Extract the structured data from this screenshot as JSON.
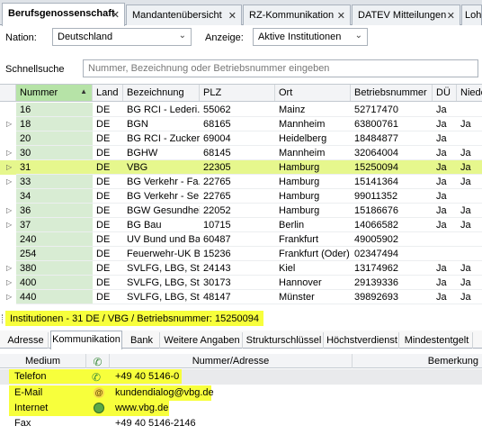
{
  "tabs": [
    {
      "label": "Berufsgenossenschaft",
      "active": true
    },
    {
      "label": "Mandantenübersicht"
    },
    {
      "label": "RZ-Kommunikation"
    },
    {
      "label": "DATEV Mitteilungen"
    },
    {
      "label": "Lohn"
    }
  ],
  "filter": {
    "nation_label": "Nation:",
    "nation_value": "Deutschland",
    "anzeige_label": "Anzeige:",
    "anzeige_value": "Aktive Institutionen",
    "search_label": "Schnellsuche",
    "search_placeholder": "Nummer, Bezeichnung oder Betriebsnummer eingeben"
  },
  "grid": {
    "columns": [
      "Nummer",
      "Land",
      "Bezeichnung",
      "PLZ",
      "Ort",
      "Betriebsnummer",
      "DÜ",
      "Niede"
    ],
    "rows": [
      {
        "nummer": "16",
        "land": "DE",
        "bez": "BG RCI - Lederi...",
        "plz": "55062",
        "ort": "Mainz",
        "bnr": "52717470",
        "du": "Ja",
        "nie": "",
        "exp": false
      },
      {
        "nummer": "18",
        "land": "DE",
        "bez": "BGN",
        "plz": "68165",
        "ort": "Mannheim",
        "bnr": "63800761",
        "du": "Ja",
        "nie": "Ja",
        "exp": true
      },
      {
        "nummer": "20",
        "land": "DE",
        "bez": "BG RCI - Zucker",
        "plz": "69004",
        "ort": "Heidelberg",
        "bnr": "18484877",
        "du": "Ja",
        "nie": "",
        "exp": false
      },
      {
        "nummer": "30",
        "land": "DE",
        "bez": "BGHW",
        "plz": "68145",
        "ort": "Mannheim",
        "bnr": "32064004",
        "du": "Ja",
        "nie": "Ja",
        "exp": true
      },
      {
        "nummer": "31",
        "land": "DE",
        "bez": "VBG",
        "plz": "22305",
        "ort": "Hamburg",
        "bnr": "15250094",
        "du": "Ja",
        "nie": "Ja",
        "exp": true,
        "selected": true
      },
      {
        "nummer": "33",
        "land": "DE",
        "bez": "BG Verkehr - Fa...",
        "plz": "22765",
        "ort": "Hamburg",
        "bnr": "15141364",
        "du": "Ja",
        "nie": "Ja",
        "exp": true
      },
      {
        "nummer": "34",
        "land": "DE",
        "bez": "BG Verkehr - Se...",
        "plz": "22765",
        "ort": "Hamburg",
        "bnr": "99011352",
        "du": "Ja",
        "nie": "",
        "exp": false
      },
      {
        "nummer": "36",
        "land": "DE",
        "bez": "BGW Gesundhei...",
        "plz": "22052",
        "ort": "Hamburg",
        "bnr": "15186676",
        "du": "Ja",
        "nie": "Ja",
        "exp": true
      },
      {
        "nummer": "37",
        "land": "DE",
        "bez": "BG Bau",
        "plz": "10715",
        "ort": "Berlin",
        "bnr": "14066582",
        "du": "Ja",
        "nie": "Ja",
        "exp": true
      },
      {
        "nummer": "240",
        "land": "DE",
        "bez": "UV Bund und Ba...",
        "plz": "60487",
        "ort": "Frankfurt",
        "bnr": "49005902",
        "du": "",
        "nie": "",
        "exp": false
      },
      {
        "nummer": "254",
        "land": "DE",
        "bez": "Feuerwehr-UK B...",
        "plz": "15236",
        "ort": "Frankfurt (Oder)",
        "bnr": "02347494",
        "du": "",
        "nie": "",
        "exp": false
      },
      {
        "nummer": "380",
        "land": "DE",
        "bez": "SVLFG, LBG, St...",
        "plz": "24143",
        "ort": "Kiel",
        "bnr": "13174962",
        "du": "Ja",
        "nie": "Ja",
        "exp": true
      },
      {
        "nummer": "400",
        "land": "DE",
        "bez": "SVLFG, LBG, St...",
        "plz": "30173",
        "ort": "Hannover",
        "bnr": "29139336",
        "du": "Ja",
        "nie": "Ja",
        "exp": true
      },
      {
        "nummer": "440",
        "land": "DE",
        "bez": "SVLFG, LBG, St...",
        "plz": "48147",
        "ort": "Münster",
        "bnr": "39892693",
        "du": "Ja",
        "nie": "Ja",
        "exp": true
      }
    ]
  },
  "status": {
    "text": "Institutionen - 31 DE / VBG / Betriebsnummer: 15250094"
  },
  "detail_tabs": [
    "Adresse",
    "Kommunikation",
    "Bank",
    "Weitere Angaben",
    "Strukturschlüssel",
    "Höchstverdienst",
    "Mindestentgelt"
  ],
  "komm": {
    "headers": [
      "Medium",
      "",
      "Nummer/Adresse",
      "Bemerkung"
    ],
    "rows": [
      {
        "medium": "Telefon",
        "icon": "phone-icon",
        "value": "+49 40 5146-0"
      },
      {
        "medium": "E-Mail",
        "icon": "at-icon",
        "value": "kundendialog@vbg.de"
      },
      {
        "medium": "Internet",
        "icon": "globe-icon",
        "value": "www.vbg.de"
      },
      {
        "medium": "Fax",
        "icon": "",
        "value": "+49 40 5146-2146"
      }
    ]
  },
  "colors": {
    "highlight": "#f7ff3c",
    "sort_header": "#b6e3a7",
    "selected_row": "#e6f78d"
  }
}
